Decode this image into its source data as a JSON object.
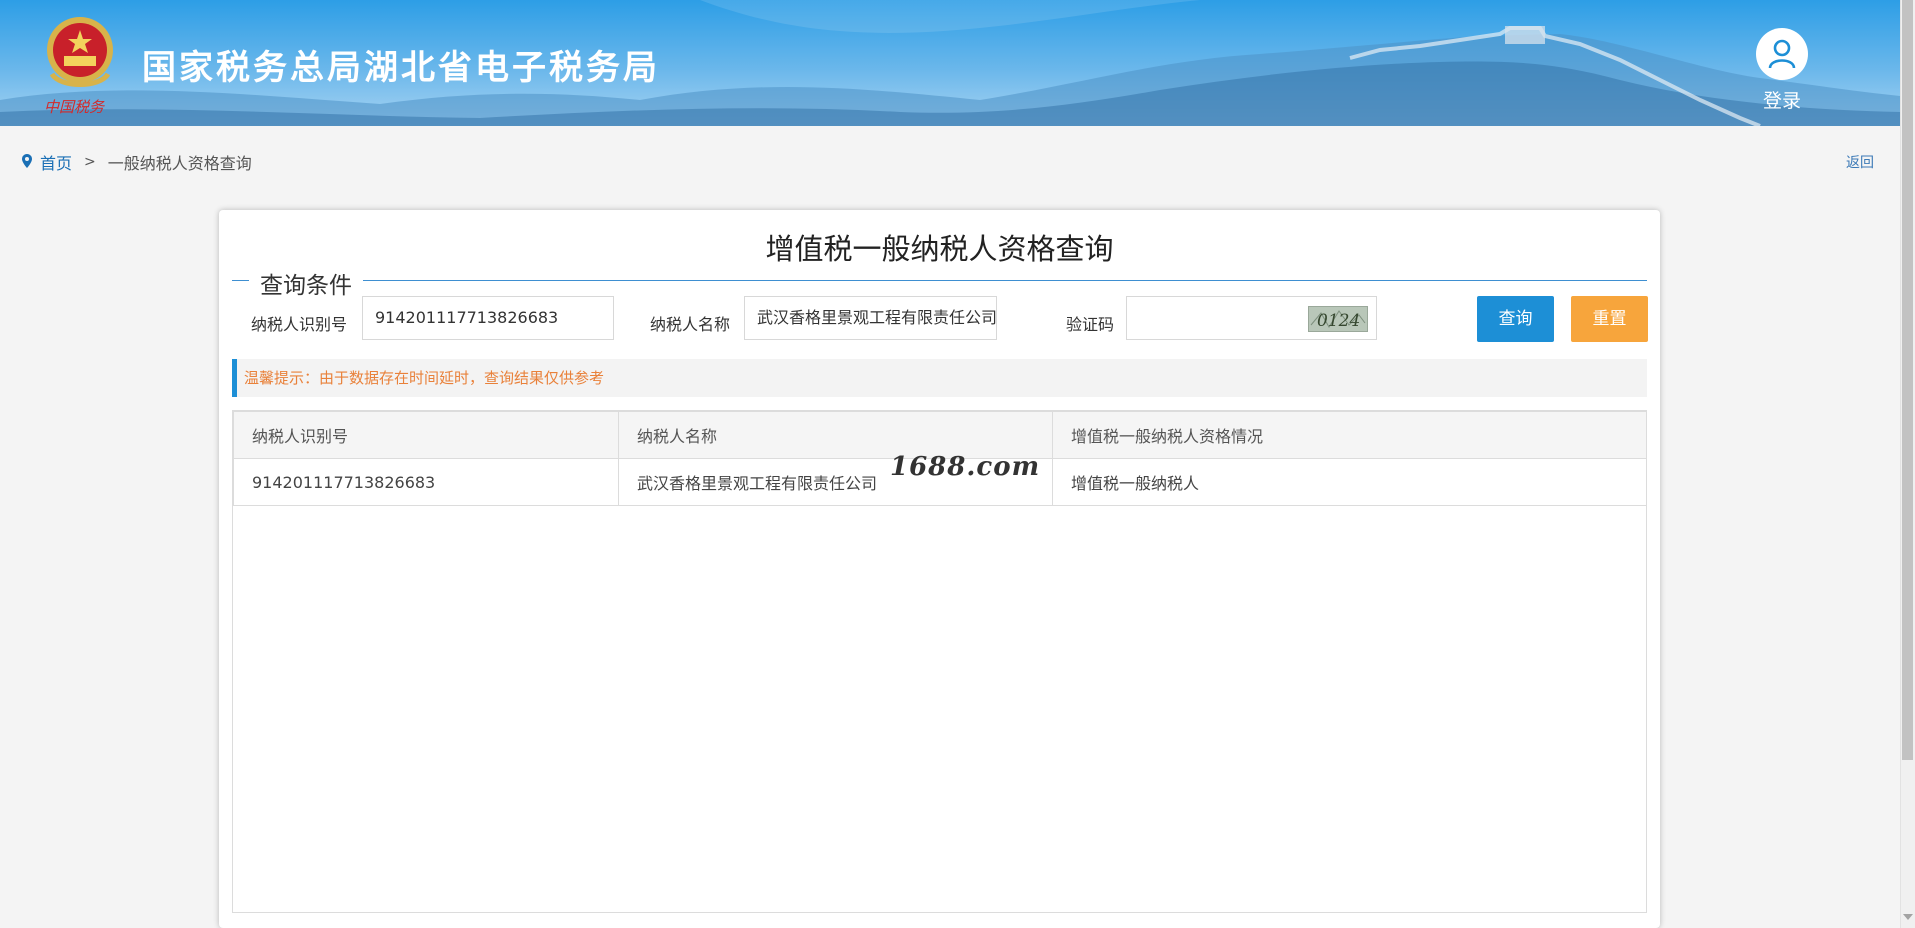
{
  "header": {
    "site_title": "国家税务总局湖北省电子税务局",
    "login_label": "登录"
  },
  "breadcrumb": {
    "home": "首页",
    "separator": ">",
    "current": "一般纳税人资格查询"
  },
  "back_label": "返回",
  "card": {
    "title": "增值税一般纳税人资格查询",
    "legend": "查询条件",
    "fields": {
      "taxpayer_id_label": "纳税人识别号",
      "taxpayer_id_value": "914201117713826683",
      "taxpayer_name_label": "纳税人名称",
      "taxpayer_name_value": "武汉香格里景观工程有限责任公司",
      "captcha_label": "验证码",
      "captcha_value": "",
      "captcha_text": "0124"
    },
    "buttons": {
      "query": "查询",
      "reset": "重置"
    },
    "tip": "温馨提示：由于数据存在时间延时，查询结果仅供参考"
  },
  "table": {
    "headers": [
      "纳税人识别号",
      "纳税人名称",
      "增值税一般纳税人资格情况"
    ],
    "rows": [
      [
        "914201117713826683",
        "武汉香格里景观工程有限责任公司",
        "增值税一般纳税人"
      ]
    ]
  },
  "watermark": "1688.com",
  "colors": {
    "header_blue": "#2d9ee6",
    "query_button": "#1d8fd6",
    "reset_button": "#f7a53c",
    "tip_text": "#e9813a",
    "link": "#1a6fb5"
  }
}
